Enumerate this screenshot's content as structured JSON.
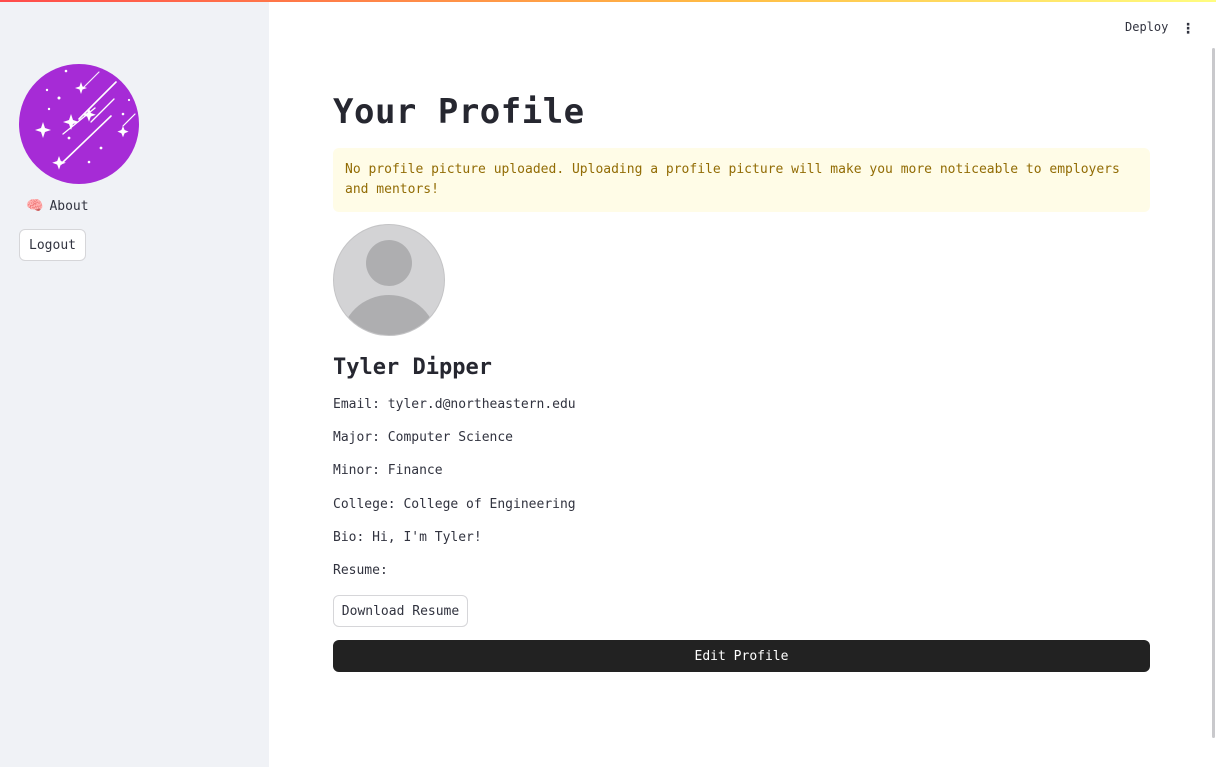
{
  "sidebar": {
    "logo_icon": "shooting-stars-logo",
    "logo_color": "#a62bd6",
    "about": {
      "emoji": "🧠",
      "label": "About"
    },
    "logout_label": "Logout"
  },
  "header": {
    "deploy_label": "Deploy",
    "menu_icon": "⋮"
  },
  "main": {
    "title": "Your Profile",
    "warning_text": "No profile picture uploaded. Uploading a profile picture will make you more noticeable to employers and mentors!",
    "avatar_icon": "default-avatar",
    "name": "Tyler Dipper",
    "fields": {
      "email": "Email: tyler.d@northeastern.edu",
      "major": "Major: Computer Science",
      "minor": "Minor: Finance",
      "college": "College: College of Engineering",
      "bio": "Bio: Hi, I'm Tyler!",
      "resume": "Resume:"
    },
    "download_label": "Download Resume",
    "edit_label": "Edit Profile"
  },
  "colors": {
    "accent_gradient": [
      "#ff4b4b",
      "#ffbd45",
      "#fffd80"
    ],
    "warning_bg": "#fffce7",
    "warning_text": "#926c05",
    "primary_button": "#222222"
  }
}
